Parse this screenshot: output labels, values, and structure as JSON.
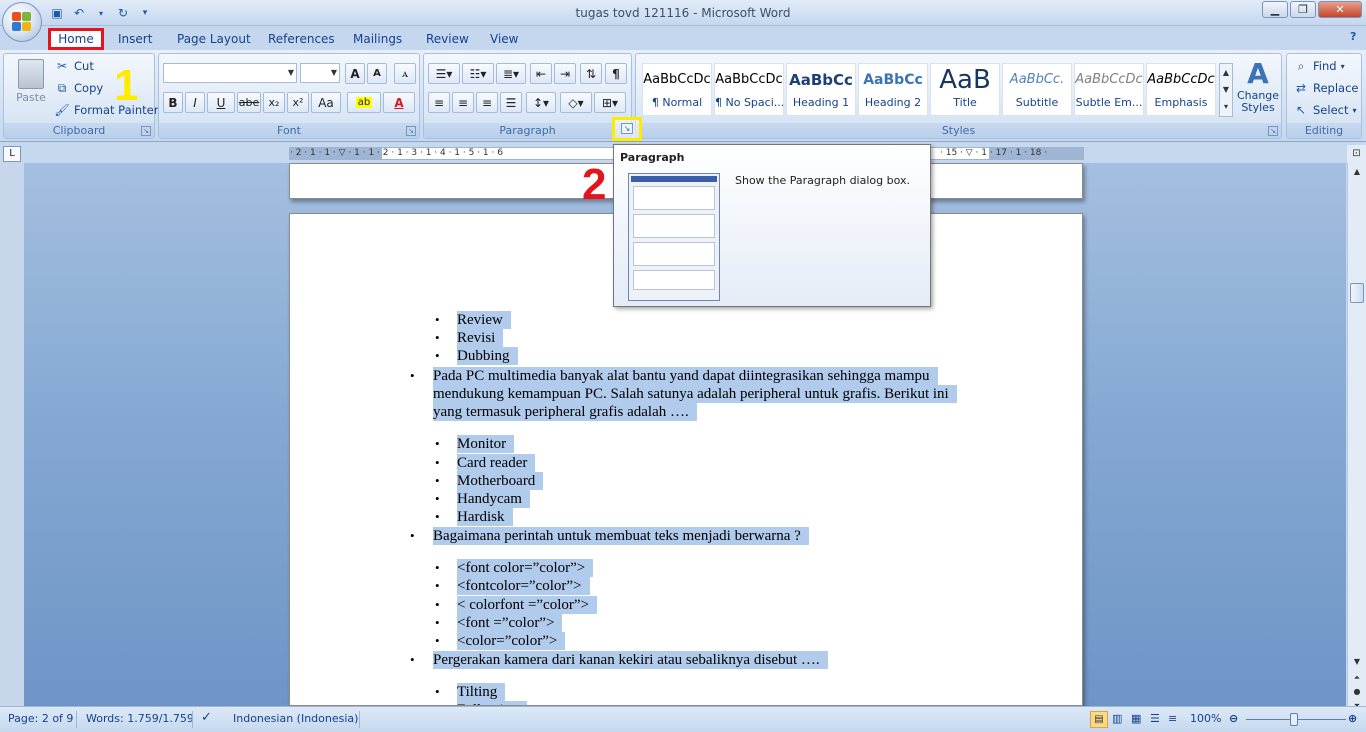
{
  "window": {
    "title": "tugas tovd 121116 - Microsoft Word"
  },
  "tabs": [
    "Home",
    "Insert",
    "Page Layout",
    "References",
    "Mailings",
    "Review",
    "View"
  ],
  "clipboard": {
    "paste": "Paste",
    "cut": "Cut",
    "copy": "Copy",
    "format_painter": "Format Painter",
    "label": "Clipboard"
  },
  "font_group": {
    "label": "Font",
    "font_name": "",
    "font_size": "",
    "grow": "A",
    "shrink": "A",
    "bold": "B",
    "italic": "I",
    "underline": "U",
    "strike": "abe",
    "subscript": "x₂",
    "superscript": "x²",
    "change_case": "Aa",
    "font_color_glyph": "A"
  },
  "paragraph_group": {
    "label": "Paragraph"
  },
  "styles_group": {
    "label": "Styles",
    "items": [
      {
        "preview": "AaBbCcDc",
        "name": "¶ Normal"
      },
      {
        "preview": "AaBbCcDc",
        "name": "¶ No Spaci..."
      },
      {
        "preview": "AaBbCc",
        "name": "Heading 1"
      },
      {
        "preview": "AaBbCc",
        "name": "Heading 2"
      },
      {
        "preview": "AaB",
        "name": "Title"
      },
      {
        "preview": "AaBbCc.",
        "name": "Subtitle"
      },
      {
        "preview": "AaBbCcDc",
        "name": "Subtle Em..."
      },
      {
        "preview": "AaBbCcDc",
        "name": "Emphasis"
      }
    ],
    "change_styles": "Change Styles"
  },
  "editing_group": {
    "label": "Editing",
    "find": "Find",
    "replace": "Replace",
    "select": "Select"
  },
  "ruler": {
    "marks": "· 2 · 1 · 1 · ▽ · 1 · 1 · 2 · 1 · 3 · 1 · 4 · 1 · 5 · 1 · 6",
    "right_marks": "· 15 · ▽ · 1 · 17 · 1 · 18 ·"
  },
  "tooltip": {
    "title": "Paragraph",
    "description": "Show the Paragraph dialog box."
  },
  "annotations": {
    "one": "1",
    "two": "2"
  },
  "document": {
    "lines": [
      {
        "text": "Review",
        "level": 2
      },
      {
        "text": "Revisi",
        "level": 2
      },
      {
        "text": "Dubbing",
        "level": 2
      },
      {
        "text": "Pada PC multimedia banyak alat bantu yand dapat diintegrasikan sehingga mampu",
        "level": 1
      },
      {
        "text": "mendukung kemampuan PC. Salah satunya adalah peripheral untuk grafis. Berikut ini",
        "level": 0
      },
      {
        "text": "yang termasuk peripheral grafis adalah ….",
        "level": 0
      },
      {
        "text": "Monitor",
        "level": 2
      },
      {
        "text": "Card reader",
        "level": 2
      },
      {
        "text": "Motherboard",
        "level": 2
      },
      {
        "text": "Handycam",
        "level": 2
      },
      {
        "text": "Hardisk",
        "level": 2
      },
      {
        "text": "Bagaimana perintah untuk membuat teks menjadi berwarna ?",
        "level": 1
      },
      {
        "text": " <font color=”color”>",
        "level": 2
      },
      {
        "text": "<fontcolor=”color”>",
        "level": 2
      },
      {
        "text": "< colorfont =”color”>",
        "level": 2
      },
      {
        "text": "<font =”color”>",
        "level": 2
      },
      {
        "text": "<color=”color”>",
        "level": 2
      },
      {
        "text": "Pergerakan kamera dari kanan kekiri atau sebaliknya disebut ….",
        "level": 1
      },
      {
        "text": "Tilting",
        "level": 2
      },
      {
        "text": "Following",
        "level": 2
      }
    ]
  },
  "status": {
    "page": "Page: 2 of 9",
    "words": "Words: 1.759/1.759",
    "language": "Indonesian (Indonesia)",
    "zoom": "100%"
  },
  "colors": {
    "highlight": "#b1cbec",
    "annotation_red": "#e3141c",
    "annotation_yellow": "#ffeb00"
  }
}
